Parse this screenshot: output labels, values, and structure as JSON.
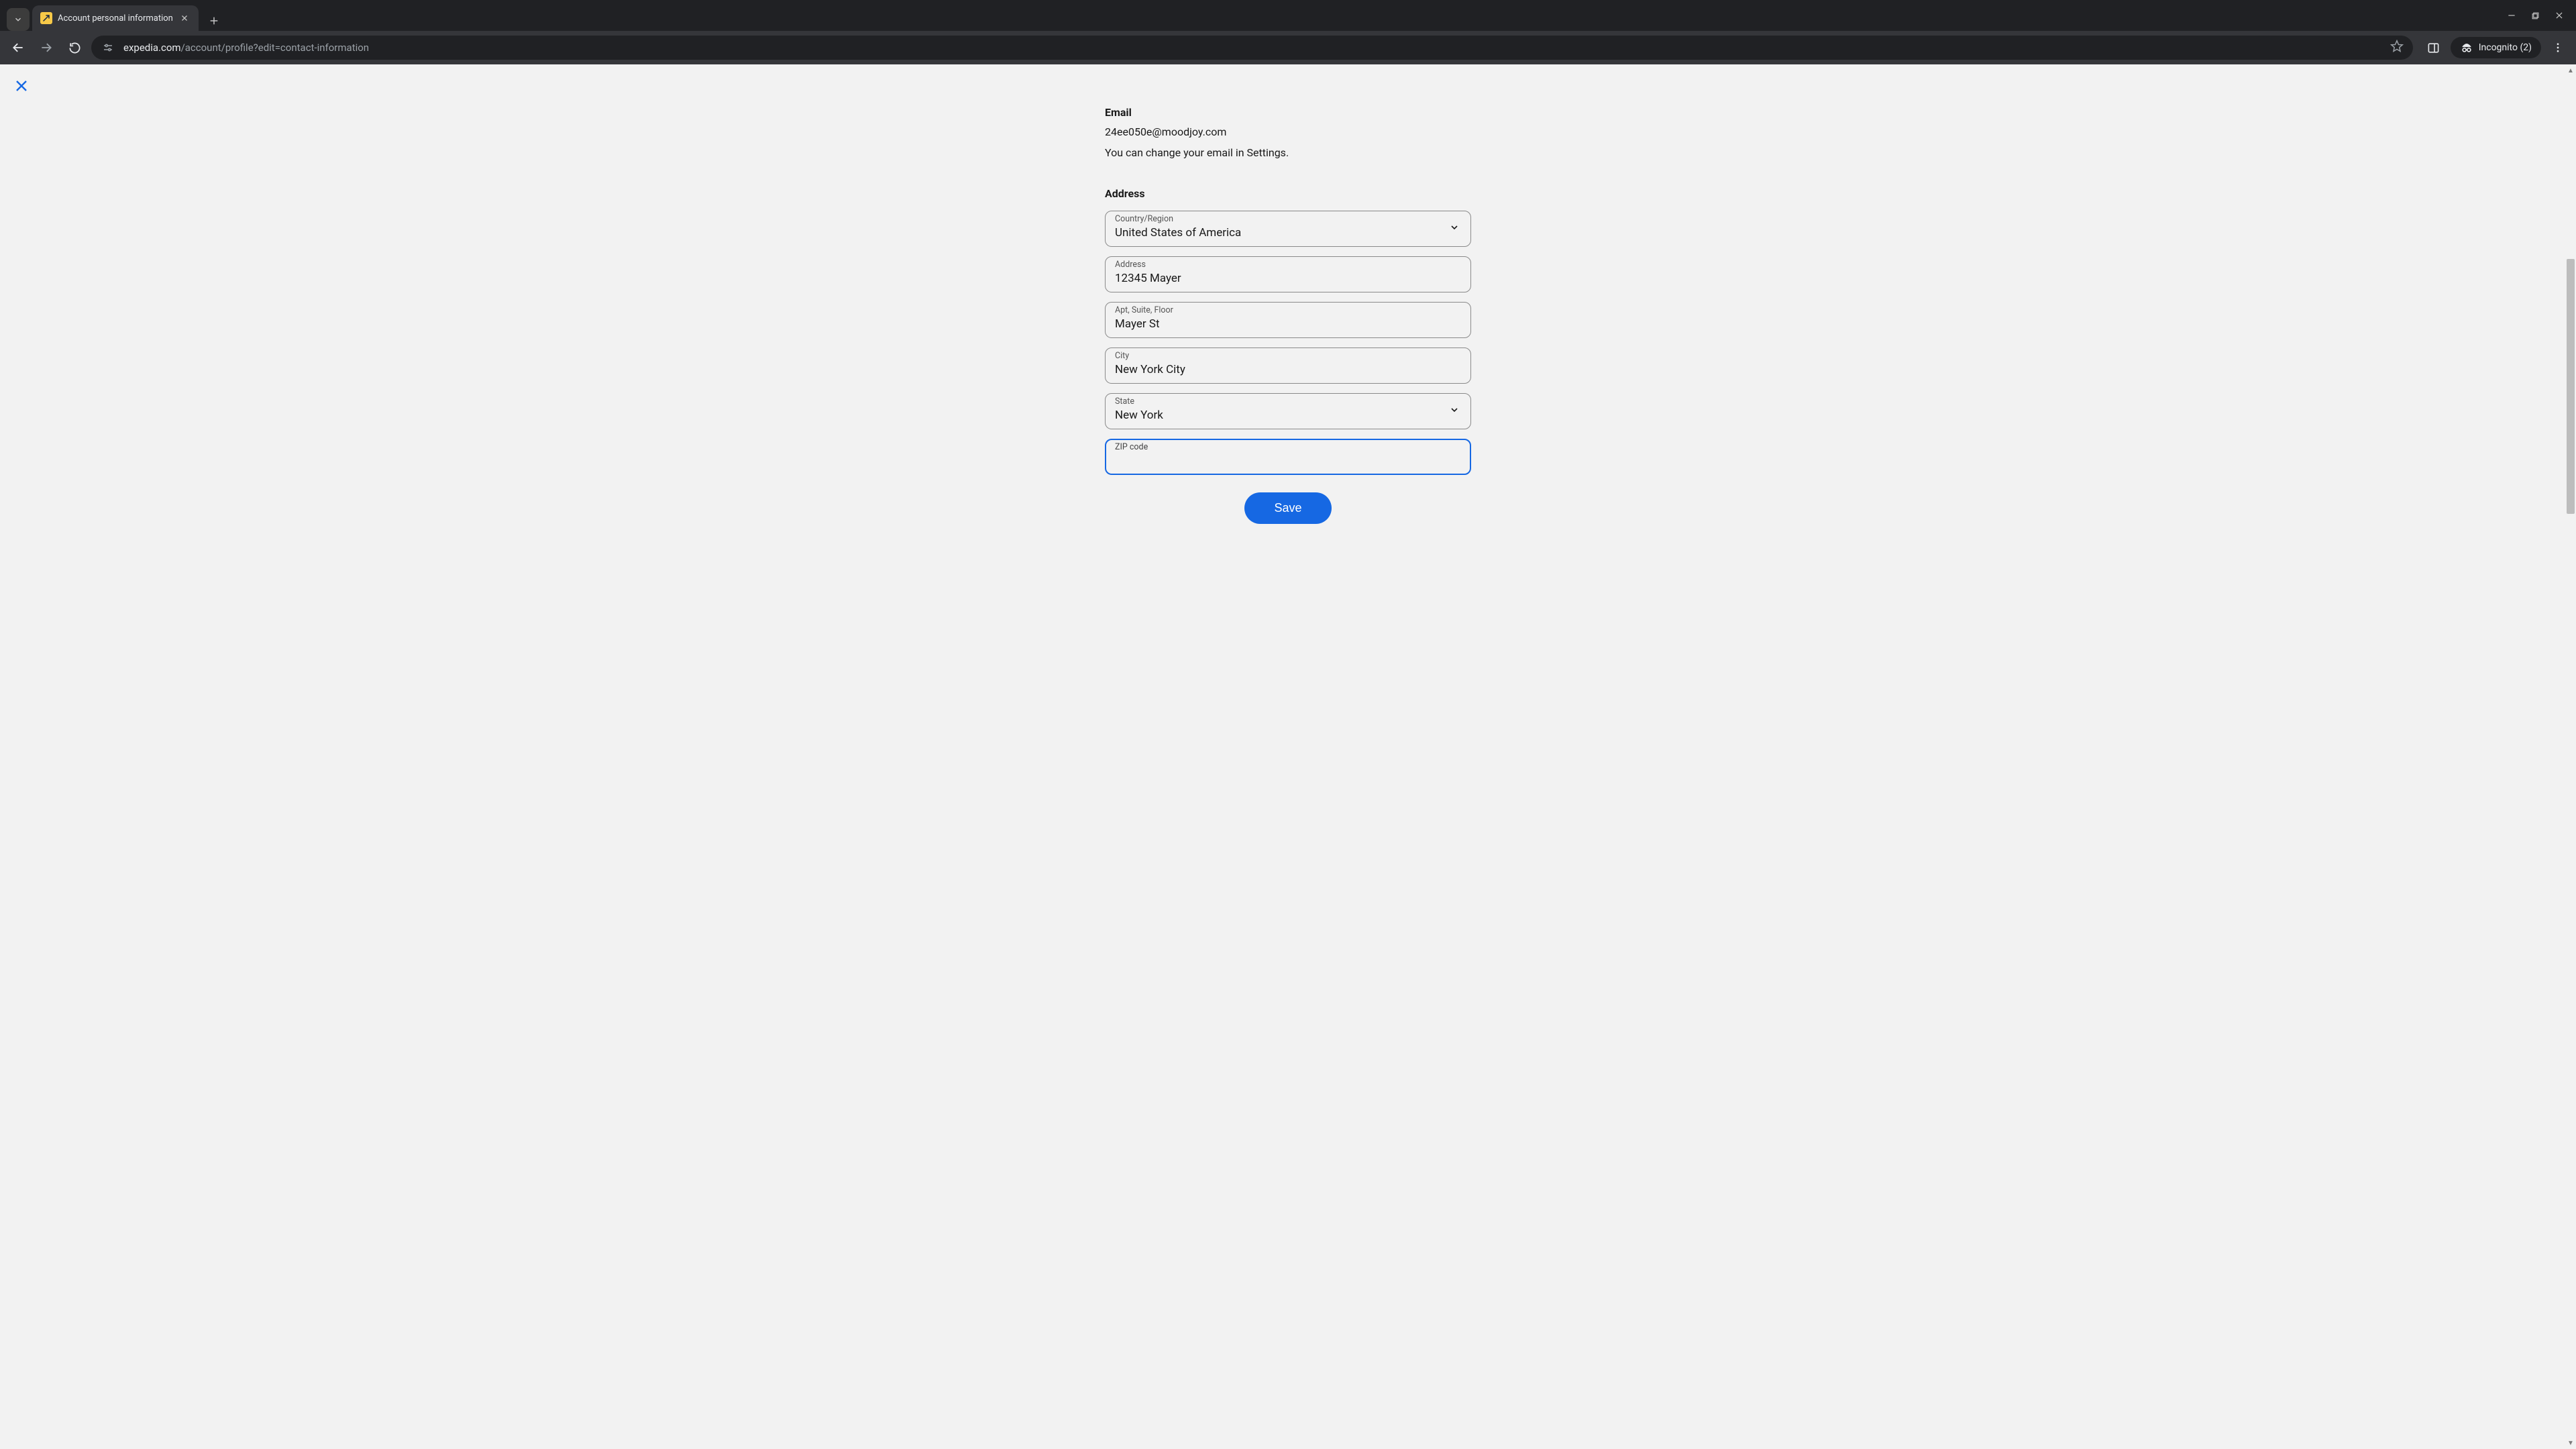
{
  "browser": {
    "tab_title": "Account personal information",
    "url_domain": "expedia.com",
    "url_path": "/account/profile?edit=contact-information",
    "incognito_label": "Incognito (2)"
  },
  "page": {
    "email_section_label": "Email",
    "email_value": "24ee050e@moodjoy.com",
    "email_hint": "You can change your email in Settings.",
    "address_section_label": "Address",
    "fields": {
      "country": {
        "label": "Country/Region",
        "value": "United States of America"
      },
      "address": {
        "label": "Address",
        "value": "12345 Mayer"
      },
      "apt": {
        "label": "Apt, Suite, Floor",
        "value": "Mayer St"
      },
      "city": {
        "label": "City",
        "value": "New York City"
      },
      "state": {
        "label": "State",
        "value": "New York"
      },
      "zip": {
        "label": "ZIP code",
        "value": ""
      }
    },
    "save_button": "Save"
  }
}
